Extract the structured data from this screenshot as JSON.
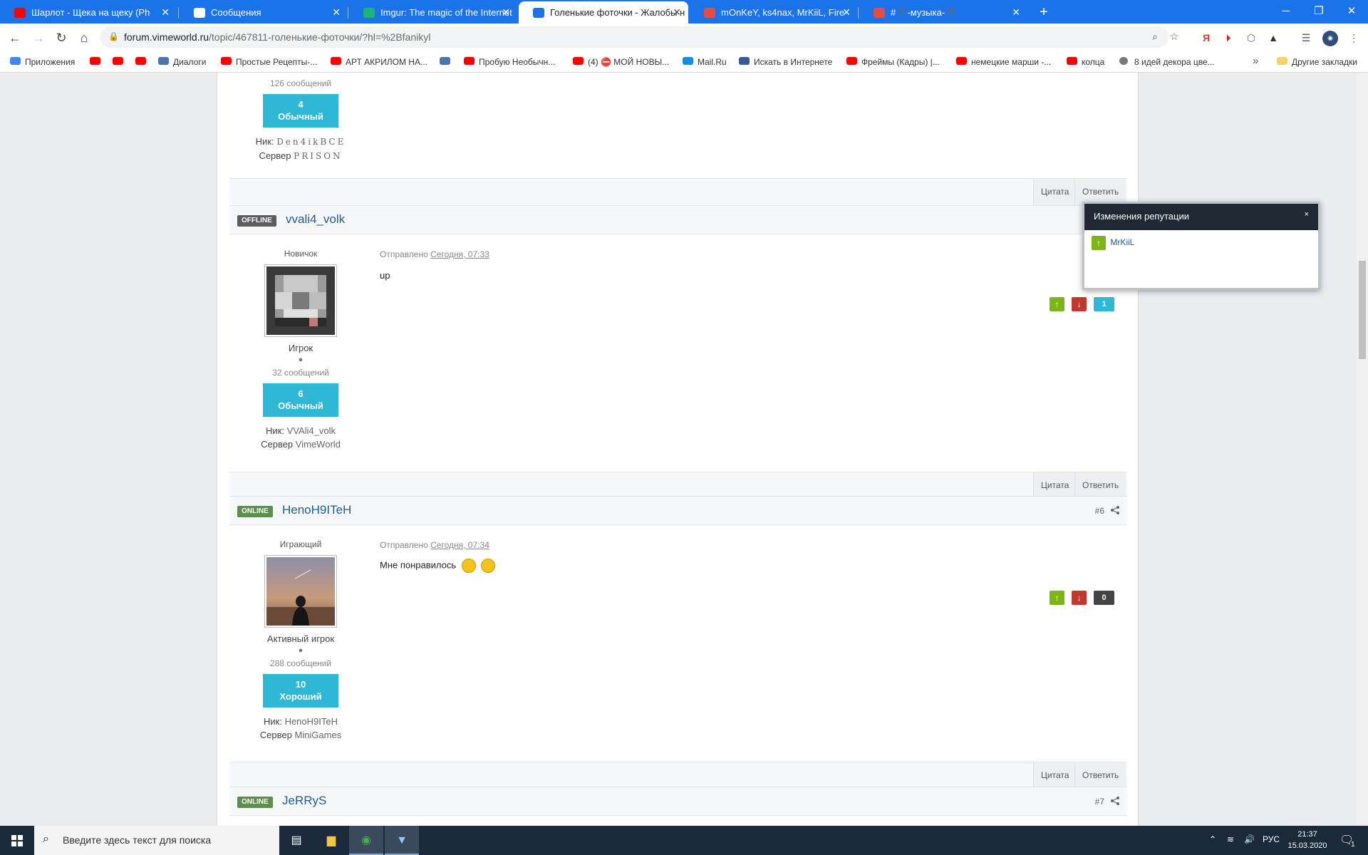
{
  "browser": {
    "tabs": [
      {
        "title": "Шарлот - Щека на щеку (Ph",
        "favicon": "youtube-icon",
        "color": "#ff0000"
      },
      {
        "title": "Сообщения",
        "favicon": "chat-icon",
        "color": "#ffffff"
      },
      {
        "title": "Imgur: The magic of the Internet",
        "favicon": "imgur-icon",
        "color": "#1bb76e"
      },
      {
        "title": "Голенькие фоточки - Жалобы н",
        "favicon": "vimeworld-icon",
        "color": "#1a73e8"
      },
      {
        "title": "mOnKeY, ks4nax, MrKiiL, Fire",
        "favicon": "calendar-icon",
        "color": "#e84c3d"
      },
      {
        "title": "#🎵-музыка-🎵",
        "favicon": "calendar-icon",
        "color": "#e84c3d"
      }
    ],
    "new_tab": "+",
    "window_controls": {
      "minimize": "─",
      "restore": "❐",
      "close": "✕"
    },
    "url_host": "forum.vimeworld.ru",
    "url_path": "/topic/467811-голенькие-фоточки/?hl=%2Bfanikyl",
    "bookmarks": [
      {
        "label": "Приложения",
        "icon": "apps-grid-icon",
        "color": "#4285f4"
      },
      {
        "label": "",
        "icon": "youtube-icon",
        "color": "#ff0000"
      },
      {
        "label": "",
        "icon": "youtube-icon",
        "color": "#ff0000"
      },
      {
        "label": "",
        "icon": "youtube-icon",
        "color": "#ff0000"
      },
      {
        "label": "Диалоги",
        "icon": "chat-icon",
        "color": "#4a76a8"
      },
      {
        "label": "Простые Рецепты-...",
        "icon": "youtube-icon",
        "color": "#ff0000"
      },
      {
        "label": "АРТ АКРИЛОМ НА...",
        "icon": "youtube-icon",
        "color": "#ff0000"
      },
      {
        "label": "",
        "icon": "vk-icon",
        "color": "#4a76a8"
      },
      {
        "label": "Пробую Необычн...",
        "icon": "youtube-icon",
        "color": "#ff0000"
      },
      {
        "label": "(4) ⛔ МОЙ НОВЫ...",
        "icon": "youtube-icon",
        "color": "#ff0000"
      },
      {
        "label": "Mail.Ru",
        "icon": "mailru-icon",
        "color": "#168de2"
      },
      {
        "label": "Искать в Интернете",
        "icon": "search-icon",
        "color": "#3b5998"
      },
      {
        "label": "Фреймы (Кадры) |...",
        "icon": "youtube-icon",
        "color": "#ff0000"
      },
      {
        "label": "немецкие марши -...",
        "icon": "youtube-icon",
        "color": "#ff0000"
      },
      {
        "label": "колца",
        "icon": "youtube-icon",
        "color": "#ff0000"
      },
      {
        "label": "8 идей декора цве...",
        "icon": "globe-icon",
        "color": "#777777"
      }
    ],
    "bookmarks_more": "»",
    "other_bookmarks": "Другие закладки"
  },
  "posts": [
    {
      "partial": true,
      "posts_count": "126 сообщений",
      "rep_value": "4",
      "rep_label": "Обычный",
      "nick_label": "Ник:",
      "nick_value": "Den4ikBCE",
      "server_label": "Сервер",
      "server_value": "PRISON",
      "quote": "Цитата",
      "reply": "Ответить"
    },
    {
      "status": "OFFLINE",
      "author": "vvali4_volk",
      "user_title": "Новичок",
      "rank": "Игрок",
      "pip": "●",
      "posts_count": "32 сообщений",
      "rep_value": "6",
      "rep_label": "Обычный",
      "nick_label": "Ник:",
      "nick_value": "VVAli4_volk",
      "server_label": "Сервер",
      "server_value": "VimeWorld",
      "date_prefix": "Отправлено",
      "date": "Сегодня, 07:33",
      "body": "up",
      "reputation": "1",
      "quote": "Цитата",
      "reply": "Ответить"
    },
    {
      "status": "ONLINE",
      "author": "HenoH9ITeH",
      "post_number": "#6",
      "user_title": "Играющий",
      "rank": "Активный игрок",
      "pip": "●",
      "posts_count": "288 сообщений",
      "rep_value": "10",
      "rep_label": "Хороший",
      "nick_label": "Ник:",
      "nick_value": "HenoH9ITeH",
      "server_label": "Сервер",
      "server_value": "MiniGames",
      "date_prefix": "Отправлено",
      "date": "Сегодня, 07:34",
      "body": "Мне понравилось",
      "reputation": "0",
      "quote": "Цитата",
      "reply": "Ответить"
    },
    {
      "status": "ONLINE",
      "author": "JeRRyS",
      "post_number": "#7"
    }
  ],
  "rep_popup": {
    "title": "Изменения репутации",
    "close": "×",
    "entries": [
      {
        "user": "MrKiiL",
        "direction": "up"
      }
    ]
  },
  "colors": {
    "rep_badge": "#2fb7d6",
    "rep_count_positive": "#2fb7d6",
    "rep_count_zero": "#444444",
    "vote_up": "#7cb518",
    "vote_down": "#c0392b",
    "link": "#1e5e8a"
  },
  "taskbar": {
    "search_placeholder": "Введите здесь текст для поиска",
    "language": "РУС",
    "time": "21:37",
    "date": "15.03.2020",
    "notifications": "1"
  }
}
